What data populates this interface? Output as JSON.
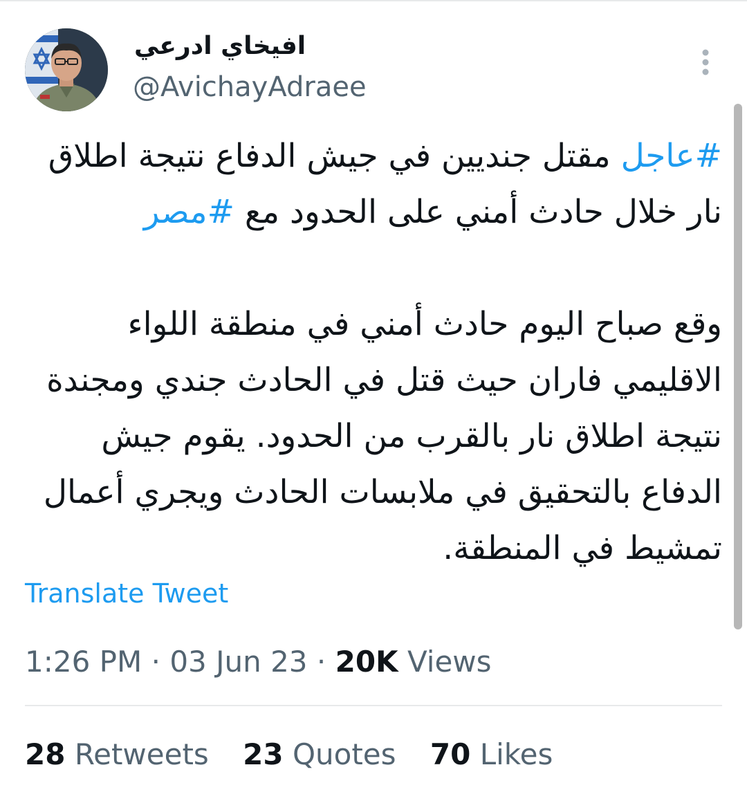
{
  "tweet": {
    "author": {
      "display_name": "افيخاي ادرعي",
      "handle": "@AvichayAdraee",
      "avatar_icon": "profile-photo"
    },
    "more_icon": "more-vertical-icon",
    "text": {
      "hashtag_1": "#عاجل",
      "part_1": " مقتل جنديين في جيش الدفاع نتيجة اطلاق نار خلال حادث أمني على الحدود مع ",
      "hashtag_2": "#مصر",
      "part_2": "\n\nوقع صباح اليوم حادث أمني في منطقة اللواء الاقليمي فاران حيث قتل في الحادث جندي ومجندة نتيجة اطلاق نار بالقرب من الحدود. يقوم جيش الدفاع بالتحقيق في ملابسات الحادث ويجري أعمال تمشيط في المنطقة."
    },
    "translate_label": "Translate Tweet",
    "time": "1:26 PM",
    "date": "03 Jun 23",
    "separator": "·",
    "views_count": "20K",
    "views_label": "Views",
    "stats": {
      "retweets_count": "28",
      "retweets_label": "Retweets",
      "quotes_count": "23",
      "quotes_label": "Quotes",
      "likes_count": "70",
      "likes_label": "Likes"
    },
    "colors": {
      "link": "#1d9bf0",
      "secondary_text": "#536471",
      "primary_text": "#0f1419",
      "divider": "#e7e9ea"
    }
  }
}
